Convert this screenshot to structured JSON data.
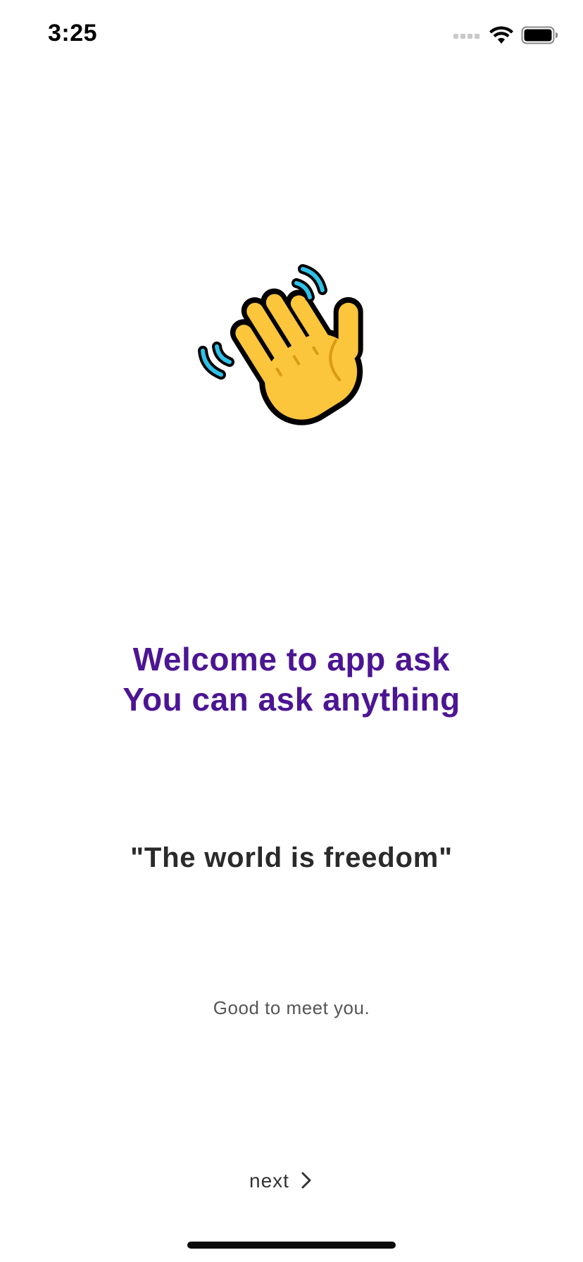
{
  "status_bar": {
    "time": "3:25"
  },
  "hero": {
    "icon": "waving-hand-icon"
  },
  "welcome": {
    "line1": "Welcome to app ask",
    "line2": "You can ask anything"
  },
  "quote": "\"The world is freedom\"",
  "greeting": "Good to meet you.",
  "navigation": {
    "next_label": "next",
    "next_icon": "chevron-right-icon"
  },
  "colors": {
    "welcome_text": "#4b1593",
    "quote_text": "#2a2a2a",
    "hand_fill": "#fbc53c",
    "motion_lines": "#2fc1e8"
  }
}
